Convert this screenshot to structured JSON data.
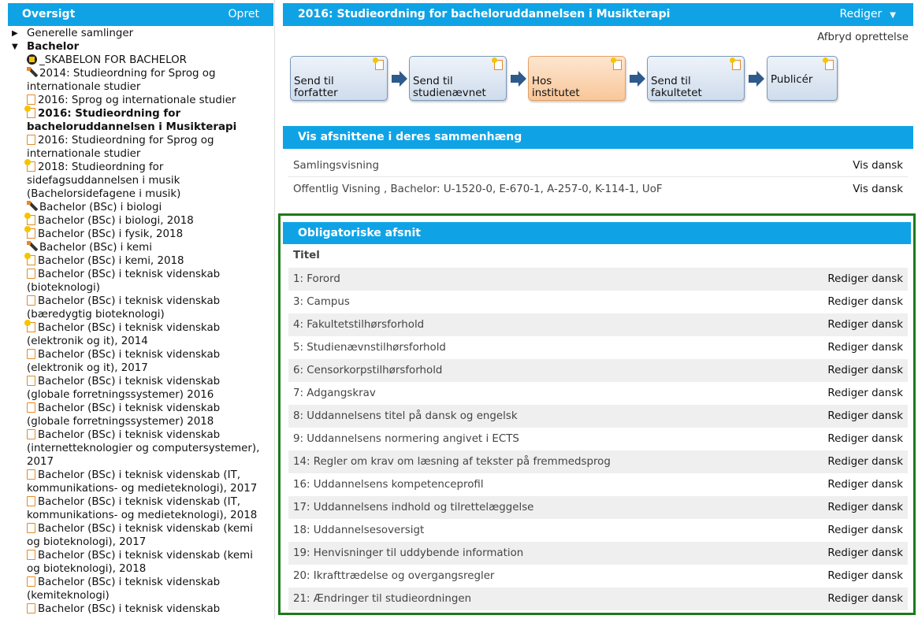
{
  "left_panel": {
    "title": "Oversigt",
    "create_label": "Opret",
    "groups": [
      {
        "label": "Generelle samlinger"
      },
      {
        "label": "Bachelor"
      }
    ],
    "items": [
      {
        "icon": "template-icon",
        "lines": [
          "_SKABELON FOR BACHELOR"
        ]
      },
      {
        "icon": "pencil-icon",
        "lines": [
          "2014: Studieordning for Sprog og",
          "internationale studier"
        ]
      },
      {
        "icon": "document-icon",
        "lines": [
          "2016: Sprog og internationale studier"
        ]
      },
      {
        "icon": "document-new-icon",
        "lines": [
          "2016: Studieordning for",
          "bacheloruddannelsen i Musikterapi"
        ],
        "selected": true
      },
      {
        "icon": "document-icon",
        "lines": [
          "2016: Studieordning for Sprog og",
          "internationale studier"
        ]
      },
      {
        "icon": "document-new-icon",
        "lines": [
          "2018: Studieordning for",
          "sidefagsuddannelsen i musik",
          "(Bachelorsidefagene i musik)"
        ]
      },
      {
        "icon": "pencil-icon",
        "lines": [
          "Bachelor (BSc) i biologi"
        ]
      },
      {
        "icon": "document-new-icon",
        "lines": [
          "Bachelor (BSc) i biologi, 2018"
        ]
      },
      {
        "icon": "document-new-icon",
        "lines": [
          "Bachelor (BSc) i fysik, 2018"
        ]
      },
      {
        "icon": "pencil-icon",
        "lines": [
          "Bachelor (BSc) i kemi"
        ]
      },
      {
        "icon": "document-new-icon",
        "lines": [
          "Bachelor (BSc) i kemi, 2018"
        ]
      },
      {
        "icon": "document-icon",
        "lines": [
          "Bachelor (BSc) i teknisk videnskab",
          "(bioteknologi)"
        ]
      },
      {
        "icon": "document-icon",
        "lines": [
          "Bachelor (BSc) i teknisk videnskab",
          "(bæredygtig bioteknologi)"
        ]
      },
      {
        "icon": "document-new-icon",
        "lines": [
          "Bachelor (BSc) i teknisk videnskab",
          "(elektronik og it), 2014"
        ]
      },
      {
        "icon": "document-icon",
        "lines": [
          "Bachelor (BSc) i teknisk videnskab",
          "(elektronik og it), 2017"
        ]
      },
      {
        "icon": "document-icon",
        "lines": [
          "Bachelor (BSc) i teknisk videnskab",
          "(globale forretningssystemer) 2016"
        ]
      },
      {
        "icon": "document-icon",
        "lines": [
          "Bachelor (BSc) i teknisk videnskab",
          "(globale forretningssystemer) 2018"
        ]
      },
      {
        "icon": "document-icon",
        "lines": [
          "Bachelor (BSc) i teknisk videnskab",
          "(internetteknologier og computersystemer),",
          "2017"
        ]
      },
      {
        "icon": "document-icon",
        "lines": [
          "Bachelor (BSc) i teknisk videnskab (IT,",
          "kommunikations- og medieteknologi), 2017"
        ]
      },
      {
        "icon": "document-icon",
        "lines": [
          "Bachelor (BSc) i teknisk videnskab (IT,",
          "kommunikations- og medieteknologi), 2018"
        ]
      },
      {
        "icon": "document-icon",
        "lines": [
          "Bachelor (BSc) i teknisk videnskab (kemi",
          "og bioteknologi), 2017"
        ]
      },
      {
        "icon": "document-icon",
        "lines": [
          "Bachelor (BSc) i teknisk videnskab (kemi",
          "og bioteknologi), 2018"
        ]
      },
      {
        "icon": "document-icon",
        "lines": [
          "Bachelor (BSc) i teknisk videnskab",
          "(kemiteknologi)"
        ]
      },
      {
        "icon": "document-icon",
        "lines": [
          "Bachelor (BSc) i teknisk videnskab"
        ]
      }
    ]
  },
  "main": {
    "title": "2016: Studieordning for bacheloruddannelsen i Musikterapi",
    "edit_menu_label": "Rediger",
    "cancel_label": "Afbryd oprettelse",
    "workflow": [
      {
        "line1": "Send til",
        "line2": "forfatter",
        "active": false
      },
      {
        "line1": "Send til",
        "line2": "studienævnet",
        "active": false
      },
      {
        "line1": "Hos",
        "line2": "institutet",
        "active": true
      },
      {
        "line1": "Send til",
        "line2": "fakultetet",
        "active": false
      },
      {
        "line1": "Publicér",
        "line2": "",
        "active": false
      }
    ],
    "context_section": {
      "title": "Vis afsnittene i deres sammenhæng",
      "rows": [
        {
          "label": "Samlingsvisning",
          "action": "Vis dansk"
        },
        {
          "label": "Offentlig Visning , Bachelor: U-1520-0, E-670-1, A-257-0, K-114-1, UoF",
          "action": "Vis dansk"
        }
      ]
    },
    "mandatory_section": {
      "title": "Obligatoriske afsnit",
      "column_header": "Titel",
      "rows": [
        {
          "label": "1: Forord",
          "action": "Rediger dansk"
        },
        {
          "label": "3: Campus",
          "action": "Rediger dansk"
        },
        {
          "label": "4: Fakultetstilhørsforhold",
          "action": "Rediger dansk"
        },
        {
          "label": "5: Studienævnstilhørsforhold",
          "action": "Rediger dansk"
        },
        {
          "label": "6: Censorkorpstilhørsforhold",
          "action": "Rediger dansk"
        },
        {
          "label": "7: Adgangskrav",
          "action": "Rediger dansk"
        },
        {
          "label": "8: Uddannelsens titel på dansk og engelsk",
          "action": "Rediger dansk"
        },
        {
          "label": "9: Uddannelsens normering angivet i ECTS",
          "action": "Rediger dansk"
        },
        {
          "label": "14: Regler om krav om læsning af tekster på fremmedsprog",
          "action": "Rediger dansk"
        },
        {
          "label": "16: Uddannelsens kompetenceprofil",
          "action": "Rediger dansk"
        },
        {
          "label": "17: Uddannelsens indhold og tilrettelæggelse",
          "action": "Rediger dansk"
        },
        {
          "label": "18: Uddannelsesoversigt",
          "action": "Rediger dansk"
        },
        {
          "label": "19: Henvisninger til uddybende information",
          "action": "Rediger dansk"
        },
        {
          "label": "20: Ikrafttrædelse og overgangsregler",
          "action": "Rediger dansk"
        },
        {
          "label": "21: Ændringer til studieordningen",
          "action": "Rediger dansk"
        }
      ]
    }
  },
  "colors": {
    "header_blue": "#0fa3e6",
    "highlight_green": "#1c7a1c",
    "active_step": "#f9c79a"
  }
}
